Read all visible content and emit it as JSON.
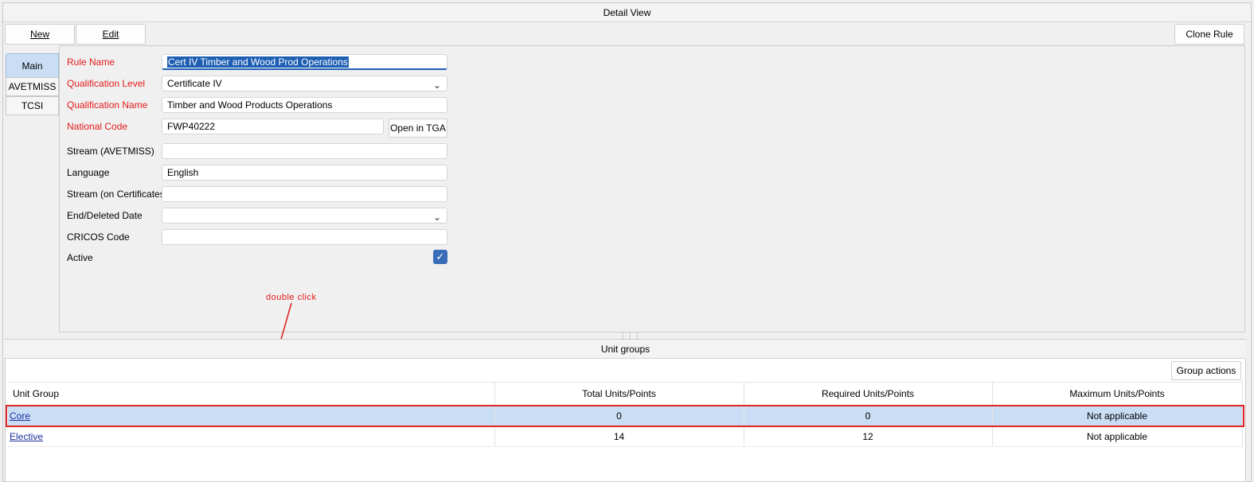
{
  "window": {
    "title": "Detail View"
  },
  "toolbar": {
    "new_label": "New",
    "edit_label": "Edit",
    "clone_label": "Clone Rule"
  },
  "tabs": [
    {
      "label": "Main",
      "active": true
    },
    {
      "label": "AVETMISS",
      "active": false
    },
    {
      "label": "TCSI",
      "active": false
    }
  ],
  "form": {
    "rule_name": {
      "label": "Rule Name",
      "value": "Cert IV Timber and Wood Prod Operations"
    },
    "qualification_level": {
      "label": "Qualification Level",
      "value": "Certificate IV"
    },
    "qualification_name": {
      "label": "Qualification Name",
      "value": "Timber and Wood Products Operations"
    },
    "national_code": {
      "label": "National Code",
      "value": "FWP40222",
      "button": "Open in TGA"
    },
    "stream_avetmiss": {
      "label": "Stream (AVETMISS)",
      "value": ""
    },
    "language": {
      "label": "Language",
      "value": "English"
    },
    "stream_certificates": {
      "label": "Stream (on Certificates)",
      "value": ""
    },
    "end_deleted_date": {
      "label": "End/Deleted Date",
      "value": ""
    },
    "cricos_code": {
      "label": "CRICOS Code",
      "value": ""
    },
    "active": {
      "label": "Active",
      "checked": true
    }
  },
  "annotation": {
    "text": "double click",
    "color": "#e21a1a"
  },
  "unit_groups": {
    "title": "Unit groups",
    "actions_label": "Group actions",
    "columns": [
      "Unit Group",
      "Total Units/Points",
      "Required Units/Points",
      "Maximum Units/Points"
    ],
    "rows": [
      {
        "group": "Core",
        "total": "0",
        "required": "0",
        "maximum": "Not applicable",
        "selected": true
      },
      {
        "group": "Elective",
        "total": "14",
        "required": "12",
        "maximum": "Not applicable",
        "selected": false
      }
    ]
  },
  "colors": {
    "required_label": "#e21a1a",
    "selection": "#c9def5",
    "accent": "#1e5fb4"
  }
}
